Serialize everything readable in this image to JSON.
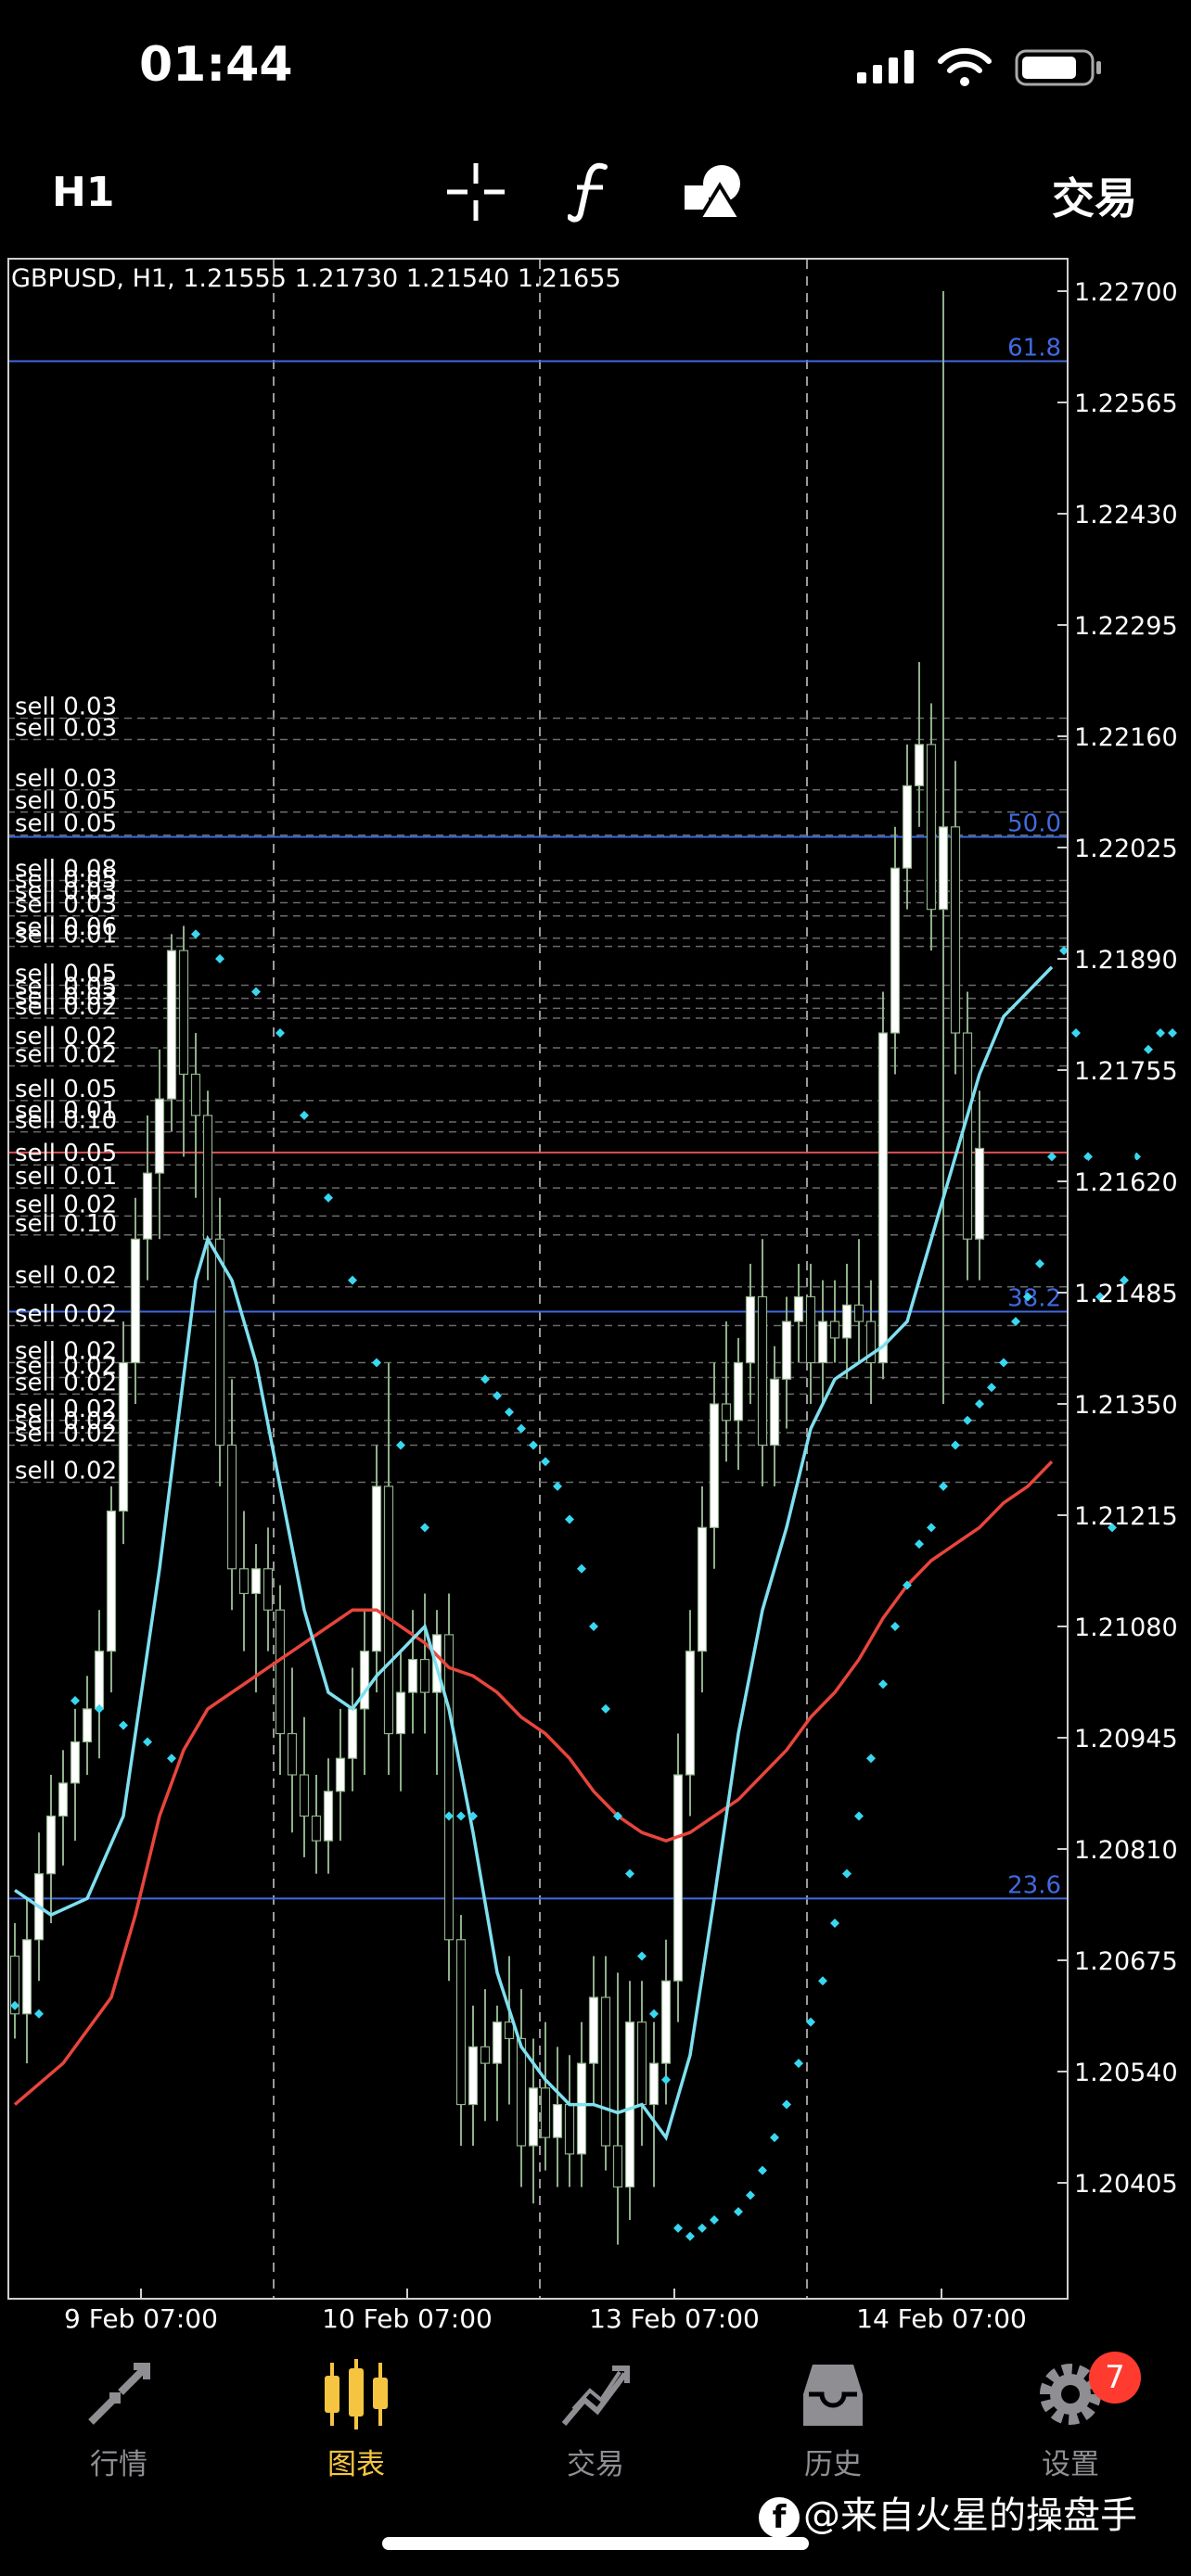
{
  "status_bar": {
    "time": "01:44"
  },
  "toolbar": {
    "timeframe": "H1",
    "trade_label": "交易",
    "icons": [
      "crosshair-icon",
      "function-icon",
      "objects-icon"
    ]
  },
  "chart": {
    "header": "GBPUSD, H1, 1.21555 1.21730 1.21540 1.21655",
    "current_price": "1.21655",
    "price_axis": [
      "1.22700",
      "1.22565",
      "1.22430",
      "1.22295",
      "1.22160",
      "1.22025",
      "1.21890",
      "1.21755",
      "1.21620",
      "1.21485",
      "1.21350",
      "1.21215",
      "1.21080",
      "1.20945",
      "1.20810",
      "1.20675",
      "1.20540",
      "1.20405"
    ],
    "time_axis": [
      "9 Feb 07:00",
      "10 Feb 07:00",
      "13 Feb 07:00",
      "14 Feb 07:00"
    ],
    "fib_levels": [
      {
        "label": "61.8",
        "price": 1.22615
      },
      {
        "label": "50.0",
        "price": 1.22038
      },
      {
        "label": "38.2",
        "price": 1.21462
      },
      {
        "label": "23.6",
        "price": 1.2075
      }
    ],
    "orders": [
      {
        "label": "sell 0.03",
        "price": 1.22182
      },
      {
        "label": "sell 0.03",
        "price": 1.22156
      },
      {
        "label": "sell 0.03",
        "price": 1.22095
      },
      {
        "label": "sell 0.05",
        "price": 1.22068
      },
      {
        "label": "sell 0.05",
        "price": 1.2204
      },
      {
        "label": "sell 0.08",
        "price": 1.21985
      },
      {
        "label": "sell 0.05",
        "price": 1.21972
      },
      {
        "label": "sell 0.03",
        "price": 1.21958
      },
      {
        "label": "sell 0.03",
        "price": 1.21942
      },
      {
        "label": "sell 0.06",
        "price": 1.21915
      },
      {
        "label": "sell 0.01",
        "price": 1.21905
      },
      {
        "label": "sell 0.05",
        "price": 1.21858
      },
      {
        "label": "sell 0.05",
        "price": 1.21842
      },
      {
        "label": "sell 0.03",
        "price": 1.2183
      },
      {
        "label": "sell 0.02",
        "price": 1.21818
      },
      {
        "label": "sell 0.02",
        "price": 1.21782
      },
      {
        "label": "sell 0.02",
        "price": 1.2176
      },
      {
        "label": "sell 0.05",
        "price": 1.21718
      },
      {
        "label": "sell 0.01",
        "price": 1.21692
      },
      {
        "label": "sell 0.10",
        "price": 1.2168
      },
      {
        "label": "sell 0.05",
        "price": 1.2164
      },
      {
        "label": "sell 0.01",
        "price": 1.21612
      },
      {
        "label": "sell 0.02",
        "price": 1.21578
      },
      {
        "label": "sell 0.10",
        "price": 1.21555
      },
      {
        "label": "sell 0.02",
        "price": 1.21492
      },
      {
        "label": "sell 0.02",
        "price": 1.21445
      },
      {
        "label": "sell 0.02",
        "price": 1.214
      },
      {
        "label": "sell 0.02",
        "price": 1.21382
      },
      {
        "label": "sell 0.02",
        "price": 1.21362
      },
      {
        "label": "sell 0.02",
        "price": 1.2133
      },
      {
        "label": "sell 0.02",
        "price": 1.21315
      },
      {
        "label": "sell 0.02",
        "price": 1.213
      },
      {
        "label": "sell 0.02",
        "price": 1.21255
      }
    ],
    "candles": [
      [
        1.2068,
        1.2072,
        1.2058,
        1.2061
      ],
      [
        1.2061,
        1.2075,
        1.2055,
        1.207
      ],
      [
        1.207,
        1.2083,
        1.2065,
        1.2078
      ],
      [
        1.2078,
        1.209,
        1.2072,
        1.2085
      ],
      [
        1.2085,
        1.2093,
        1.2079,
        1.2089
      ],
      [
        1.2089,
        1.2098,
        1.2082,
        1.2094
      ],
      [
        1.2094,
        1.2102,
        1.209,
        1.2098
      ],
      [
        1.2098,
        1.211,
        1.2092,
        1.2105
      ],
      [
        1.2105,
        1.2125,
        1.21,
        1.2122
      ],
      [
        1.2122,
        1.2145,
        1.2118,
        1.214
      ],
      [
        1.214,
        1.216,
        1.2135,
        1.2155
      ],
      [
        1.2155,
        1.217,
        1.215,
        1.2163
      ],
      [
        1.2163,
        1.2178,
        1.2155,
        1.2172
      ],
      [
        1.2172,
        1.2192,
        1.2168,
        1.219
      ],
      [
        1.219,
        1.2193,
        1.2165,
        1.2175
      ],
      [
        1.2175,
        1.218,
        1.216,
        1.217
      ],
      [
        1.217,
        1.2173,
        1.215,
        1.2155
      ],
      [
        1.2155,
        1.216,
        1.2125,
        1.213
      ],
      [
        1.213,
        1.2138,
        1.211,
        1.2115
      ],
      [
        1.2115,
        1.2122,
        1.2105,
        1.2112
      ],
      [
        1.2112,
        1.2118,
        1.21,
        1.2115
      ],
      [
        1.2115,
        1.212,
        1.2105,
        1.211
      ],
      [
        1.211,
        1.2113,
        1.209,
        1.2095
      ],
      [
        1.2095,
        1.2103,
        1.2083,
        1.209
      ],
      [
        1.209,
        1.2097,
        1.208,
        1.2085
      ],
      [
        1.2085,
        1.209,
        1.2078,
        1.2082
      ],
      [
        1.2082,
        1.2092,
        1.2078,
        1.2088
      ],
      [
        1.2088,
        1.2098,
        1.2082,
        1.2092
      ],
      [
        1.2092,
        1.2103,
        1.2088,
        1.2098
      ],
      [
        1.2098,
        1.211,
        1.209,
        1.2105
      ],
      [
        1.2105,
        1.213,
        1.21,
        1.2125
      ],
      [
        1.2125,
        1.214,
        1.209,
        1.2095
      ],
      [
        1.2095,
        1.2105,
        1.2088,
        1.21
      ],
      [
        1.21,
        1.211,
        1.2095,
        1.2104
      ],
      [
        1.2104,
        1.2112,
        1.2095,
        1.21
      ],
      [
        1.21,
        1.211,
        1.209,
        1.2107
      ],
      [
        1.2107,
        1.2112,
        1.2065,
        1.207
      ],
      [
        1.207,
        1.2073,
        1.2045,
        1.205
      ],
      [
        1.205,
        1.2062,
        1.2045,
        1.2057
      ],
      [
        1.2057,
        1.2064,
        1.2048,
        1.2055
      ],
      [
        1.2055,
        1.2062,
        1.2048,
        1.206
      ],
      [
        1.206,
        1.2068,
        1.205,
        1.2058
      ],
      [
        1.2058,
        1.2064,
        1.204,
        1.2045
      ],
      [
        1.2045,
        1.2058,
        1.2038,
        1.2052
      ],
      [
        1.2052,
        1.206,
        1.2042,
        1.2046
      ],
      [
        1.2046,
        1.2057,
        1.204,
        1.205
      ],
      [
        1.205,
        1.2056,
        1.204,
        1.2044
      ],
      [
        1.2044,
        1.206,
        1.204,
        1.2055
      ],
      [
        1.2055,
        1.2068,
        1.205,
        1.2063
      ],
      [
        1.2063,
        1.2068,
        1.2042,
        1.2045
      ],
      [
        1.2045,
        1.2066,
        1.2033,
        1.204
      ],
      [
        1.204,
        1.2065,
        1.2036,
        1.206
      ],
      [
        1.206,
        1.2065,
        1.2045,
        1.205
      ],
      [
        1.205,
        1.206,
        1.204,
        1.2055
      ],
      [
        1.2055,
        1.207,
        1.205,
        1.2065
      ],
      [
        1.2065,
        1.2095,
        1.206,
        1.209
      ],
      [
        1.209,
        1.211,
        1.2085,
        1.2105
      ],
      [
        1.2105,
        1.2125,
        1.21,
        1.212
      ],
      [
        1.212,
        1.214,
        1.2115,
        1.2135
      ],
      [
        1.2135,
        1.2145,
        1.2128,
        1.2133
      ],
      [
        1.2133,
        1.2143,
        1.2127,
        1.214
      ],
      [
        1.214,
        1.2152,
        1.2135,
        1.2148
      ],
      [
        1.2148,
        1.2155,
        1.2125,
        1.213
      ],
      [
        1.213,
        1.2142,
        1.2125,
        1.2138
      ],
      [
        1.2138,
        1.2148,
        1.2132,
        1.2145
      ],
      [
        1.2145,
        1.2152,
        1.214,
        1.2148
      ],
      [
        1.2148,
        1.2152,
        1.2135,
        1.214
      ],
      [
        1.214,
        1.215,
        1.2135,
        1.2145
      ],
      [
        1.2145,
        1.215,
        1.214,
        1.2143
      ],
      [
        1.2143,
        1.2152,
        1.2138,
        1.2147
      ],
      [
        1.2147,
        1.2155,
        1.214,
        1.2145
      ],
      [
        1.2145,
        1.215,
        1.2135,
        1.214
      ],
      [
        1.214,
        1.2185,
        1.2138,
        1.218
      ],
      [
        1.218,
        1.2205,
        1.2175,
        1.22
      ],
      [
        1.22,
        1.2215,
        1.2195,
        1.221
      ],
      [
        1.221,
        1.2225,
        1.2205,
        1.2215
      ],
      [
        1.2215,
        1.222,
        1.219,
        1.2195
      ],
      [
        1.2195,
        1.227,
        1.2135,
        1.2205
      ],
      [
        1.2205,
        1.2213,
        1.2175,
        1.218
      ],
      [
        1.218,
        1.2185,
        1.215,
        1.2155
      ],
      [
        1.2155,
        1.2173,
        1.215,
        1.2166
      ]
    ],
    "parabolic_sar": [
      [
        5,
        1.2099
      ],
      [
        7,
        1.2098
      ],
      [
        9,
        1.2096
      ],
      [
        11,
        1.2094
      ],
      [
        13,
        1.2092
      ],
      [
        0,
        1.2062
      ],
      [
        2,
        1.2061
      ],
      [
        15,
        1.2192
      ],
      [
        17,
        1.2189
      ],
      [
        20,
        1.2185
      ],
      [
        22,
        1.218
      ],
      [
        24,
        1.217
      ],
      [
        26,
        1.216
      ],
      [
        28,
        1.215
      ],
      [
        30,
        1.214
      ],
      [
        32,
        1.213
      ],
      [
        34,
        1.212
      ],
      [
        36,
        1.2085
      ],
      [
        37,
        1.2085
      ],
      [
        38,
        1.2085
      ],
      [
        39,
        1.2138
      ],
      [
        40,
        1.2136
      ],
      [
        41,
        1.2134
      ],
      [
        42,
        1.2132
      ],
      [
        43,
        1.213
      ],
      [
        44,
        1.2128
      ],
      [
        45,
        1.2125
      ],
      [
        46,
        1.2121
      ],
      [
        47,
        1.2115
      ],
      [
        48,
        1.2108
      ],
      [
        49,
        1.2098
      ],
      [
        50,
        1.2085
      ],
      [
        51,
        1.2078
      ],
      [
        52,
        1.2068
      ],
      [
        53,
        1.2061
      ],
      [
        54,
        1.2053
      ],
      [
        55,
        1.2035
      ],
      [
        56,
        1.2034
      ],
      [
        57,
        1.2035
      ],
      [
        58,
        1.2036
      ],
      [
        60,
        1.2037
      ],
      [
        61,
        1.2039
      ],
      [
        62,
        1.2042
      ],
      [
        63,
        1.2046
      ],
      [
        64,
        1.205
      ],
      [
        65,
        1.2055
      ],
      [
        66,
        1.206
      ],
      [
        67,
        1.2065
      ],
      [
        68,
        1.2072
      ],
      [
        69,
        1.2078
      ],
      [
        70,
        1.2085
      ],
      [
        71,
        1.2092
      ],
      [
        72,
        1.2101
      ],
      [
        73,
        1.2108
      ],
      [
        74,
        1.2113
      ],
      [
        75,
        1.2118
      ],
      [
        76,
        1.212
      ],
      [
        77,
        1.2125
      ],
      [
        78,
        1.213
      ],
      [
        79,
        1.2133
      ],
      [
        80,
        1.2135
      ],
      [
        81,
        1.2137
      ],
      [
        82,
        1.214
      ],
      [
        83,
        1.2145
      ],
      [
        84,
        1.2148
      ],
      [
        85,
        1.2152
      ],
      [
        86,
        1.2165
      ],
      [
        87,
        1.219
      ],
      [
        88,
        1.218
      ],
      [
        89,
        1.2165
      ],
      [
        90,
        1.2148
      ],
      [
        91,
        1.212
      ],
      [
        92,
        1.215
      ],
      [
        93,
        1.2165
      ],
      [
        94,
        1.2178
      ],
      [
        95,
        1.218
      ],
      [
        96,
        1.218
      ]
    ],
    "ma_fast": [
      [
        0,
        1.2076
      ],
      [
        3,
        1.2073
      ],
      [
        6,
        1.2075
      ],
      [
        9,
        1.2085
      ],
      [
        12,
        1.2115
      ],
      [
        15,
        1.215
      ],
      [
        16,
        1.2155
      ],
      [
        18,
        1.215
      ],
      [
        20,
        1.214
      ],
      [
        22,
        1.2125
      ],
      [
        24,
        1.211
      ],
      [
        26,
        1.21
      ],
      [
        28,
        1.2098
      ],
      [
        30,
        1.2102
      ],
      [
        32,
        1.2105
      ],
      [
        34,
        1.2108
      ],
      [
        36,
        1.2098
      ],
      [
        38,
        1.2083
      ],
      [
        40,
        1.2066
      ],
      [
        42,
        1.2057
      ],
      [
        44,
        1.2053
      ],
      [
        46,
        1.205
      ],
      [
        48,
        1.205
      ],
      [
        50,
        1.2049
      ],
      [
        52,
        1.205
      ],
      [
        54,
        1.2046
      ],
      [
        56,
        1.2056
      ],
      [
        58,
        1.2075
      ],
      [
        60,
        1.2095
      ],
      [
        62,
        1.211
      ],
      [
        64,
        1.212
      ],
      [
        66,
        1.2132
      ],
      [
        68,
        1.2138
      ],
      [
        70,
        1.214
      ],
      [
        72,
        1.2142
      ],
      [
        74,
        1.2145
      ],
      [
        76,
        1.2155
      ],
      [
        78,
        1.2165
      ],
      [
        80,
        1.2175
      ],
      [
        82,
        1.2182
      ],
      [
        84,
        1.2185
      ],
      [
        86,
        1.2188
      ]
    ],
    "ma_slow": [
      [
        0,
        1.205
      ],
      [
        4,
        1.2055
      ],
      [
        8,
        1.2063
      ],
      [
        10,
        1.2073
      ],
      [
        12,
        1.2085
      ],
      [
        14,
        1.2093
      ],
      [
        16,
        1.2098
      ],
      [
        18,
        1.21
      ],
      [
        20,
        1.2102
      ],
      [
        22,
        1.2104
      ],
      [
        24,
        1.2106
      ],
      [
        26,
        1.2108
      ],
      [
        28,
        1.211
      ],
      [
        30,
        1.211
      ],
      [
        32,
        1.2108
      ],
      [
        34,
        1.2106
      ],
      [
        36,
        1.2103
      ],
      [
        38,
        1.2102
      ],
      [
        40,
        1.21
      ],
      [
        42,
        1.2097
      ],
      [
        44,
        1.2095
      ],
      [
        46,
        1.2092
      ],
      [
        48,
        1.2088
      ],
      [
        50,
        1.2085
      ],
      [
        52,
        1.2083
      ],
      [
        54,
        1.2082
      ],
      [
        56,
        1.2083
      ],
      [
        58,
        1.2085
      ],
      [
        60,
        1.2087
      ],
      [
        62,
        1.209
      ],
      [
        64,
        1.2093
      ],
      [
        66,
        1.2097
      ],
      [
        68,
        1.21
      ],
      [
        70,
        1.2104
      ],
      [
        72,
        1.2109
      ],
      [
        74,
        1.2113
      ],
      [
        76,
        1.2116
      ],
      [
        78,
        1.2118
      ],
      [
        80,
        1.212
      ],
      [
        82,
        1.2123
      ],
      [
        84,
        1.2125
      ],
      [
        86,
        1.2128
      ]
    ],
    "colors": {
      "background": "#000000",
      "frame": "#cfcfcf",
      "grid": "#9a9a9a",
      "bull_body": "#ffffff",
      "bear_body": "#000000",
      "wick": "#8fb08a",
      "fib": "#4169e1",
      "order": "#6b6b6b",
      "current_price_line": "#e05050",
      "sar": "#39d7f0",
      "ma_fast": "#7fe0f0",
      "ma_slow": "#e8453c",
      "price_label_bg": "#8c8c9c"
    }
  },
  "tabbar": {
    "tabs": [
      {
        "label": "行情",
        "icon": "quotes-arrows-icon"
      },
      {
        "label": "图表",
        "icon": "candlestick-chart-icon",
        "active": true
      },
      {
        "label": "交易",
        "icon": "trade-trend-icon"
      },
      {
        "label": "历史",
        "icon": "history-inbox-icon"
      },
      {
        "label": "设置",
        "icon": "settings-gear-icon"
      }
    ],
    "settings_badge": "7"
  },
  "watermark": {
    "text": "@来自火星的操盘手"
  }
}
